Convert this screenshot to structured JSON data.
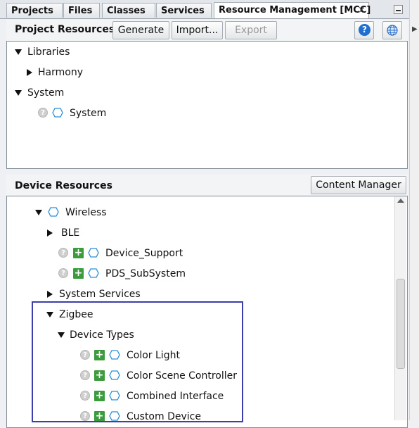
{
  "tabs": [
    {
      "label": "Projects"
    },
    {
      "label": "Files"
    },
    {
      "label": "Classes"
    },
    {
      "label": "Services"
    },
    {
      "label": "Resource Management [MCC]",
      "close": "×"
    }
  ],
  "project_resources": {
    "title": "Project Resources",
    "buttons": {
      "generate": "Generate",
      "import": "Import...",
      "export": "Export"
    },
    "tree": {
      "libraries": "Libraries",
      "harmony": "Harmony",
      "system": "System",
      "system_child": "System"
    }
  },
  "device_resources": {
    "title": "Device Resources",
    "content_manager": "Content Manager",
    "tree": {
      "wireless": "Wireless",
      "ble": "BLE",
      "device_support": "Device_Support",
      "pds_subsystem": "PDS_SubSystem",
      "system_services": "System Services",
      "zigbee": "Zigbee",
      "device_types": "Device Types",
      "color_light": "Color Light",
      "color_scene_controller": "Color Scene Controller",
      "combined_interface": "Combined Interface",
      "custom_device": "Custom Device"
    }
  },
  "icons": {
    "help": "?",
    "unknown": "?",
    "add": "+"
  },
  "colors": {
    "help_blue": "#1f6fd1",
    "add_green": "#3c9b3c",
    "hex_blue": "#2a8fd6",
    "highlight": "#3c3fa8"
  }
}
